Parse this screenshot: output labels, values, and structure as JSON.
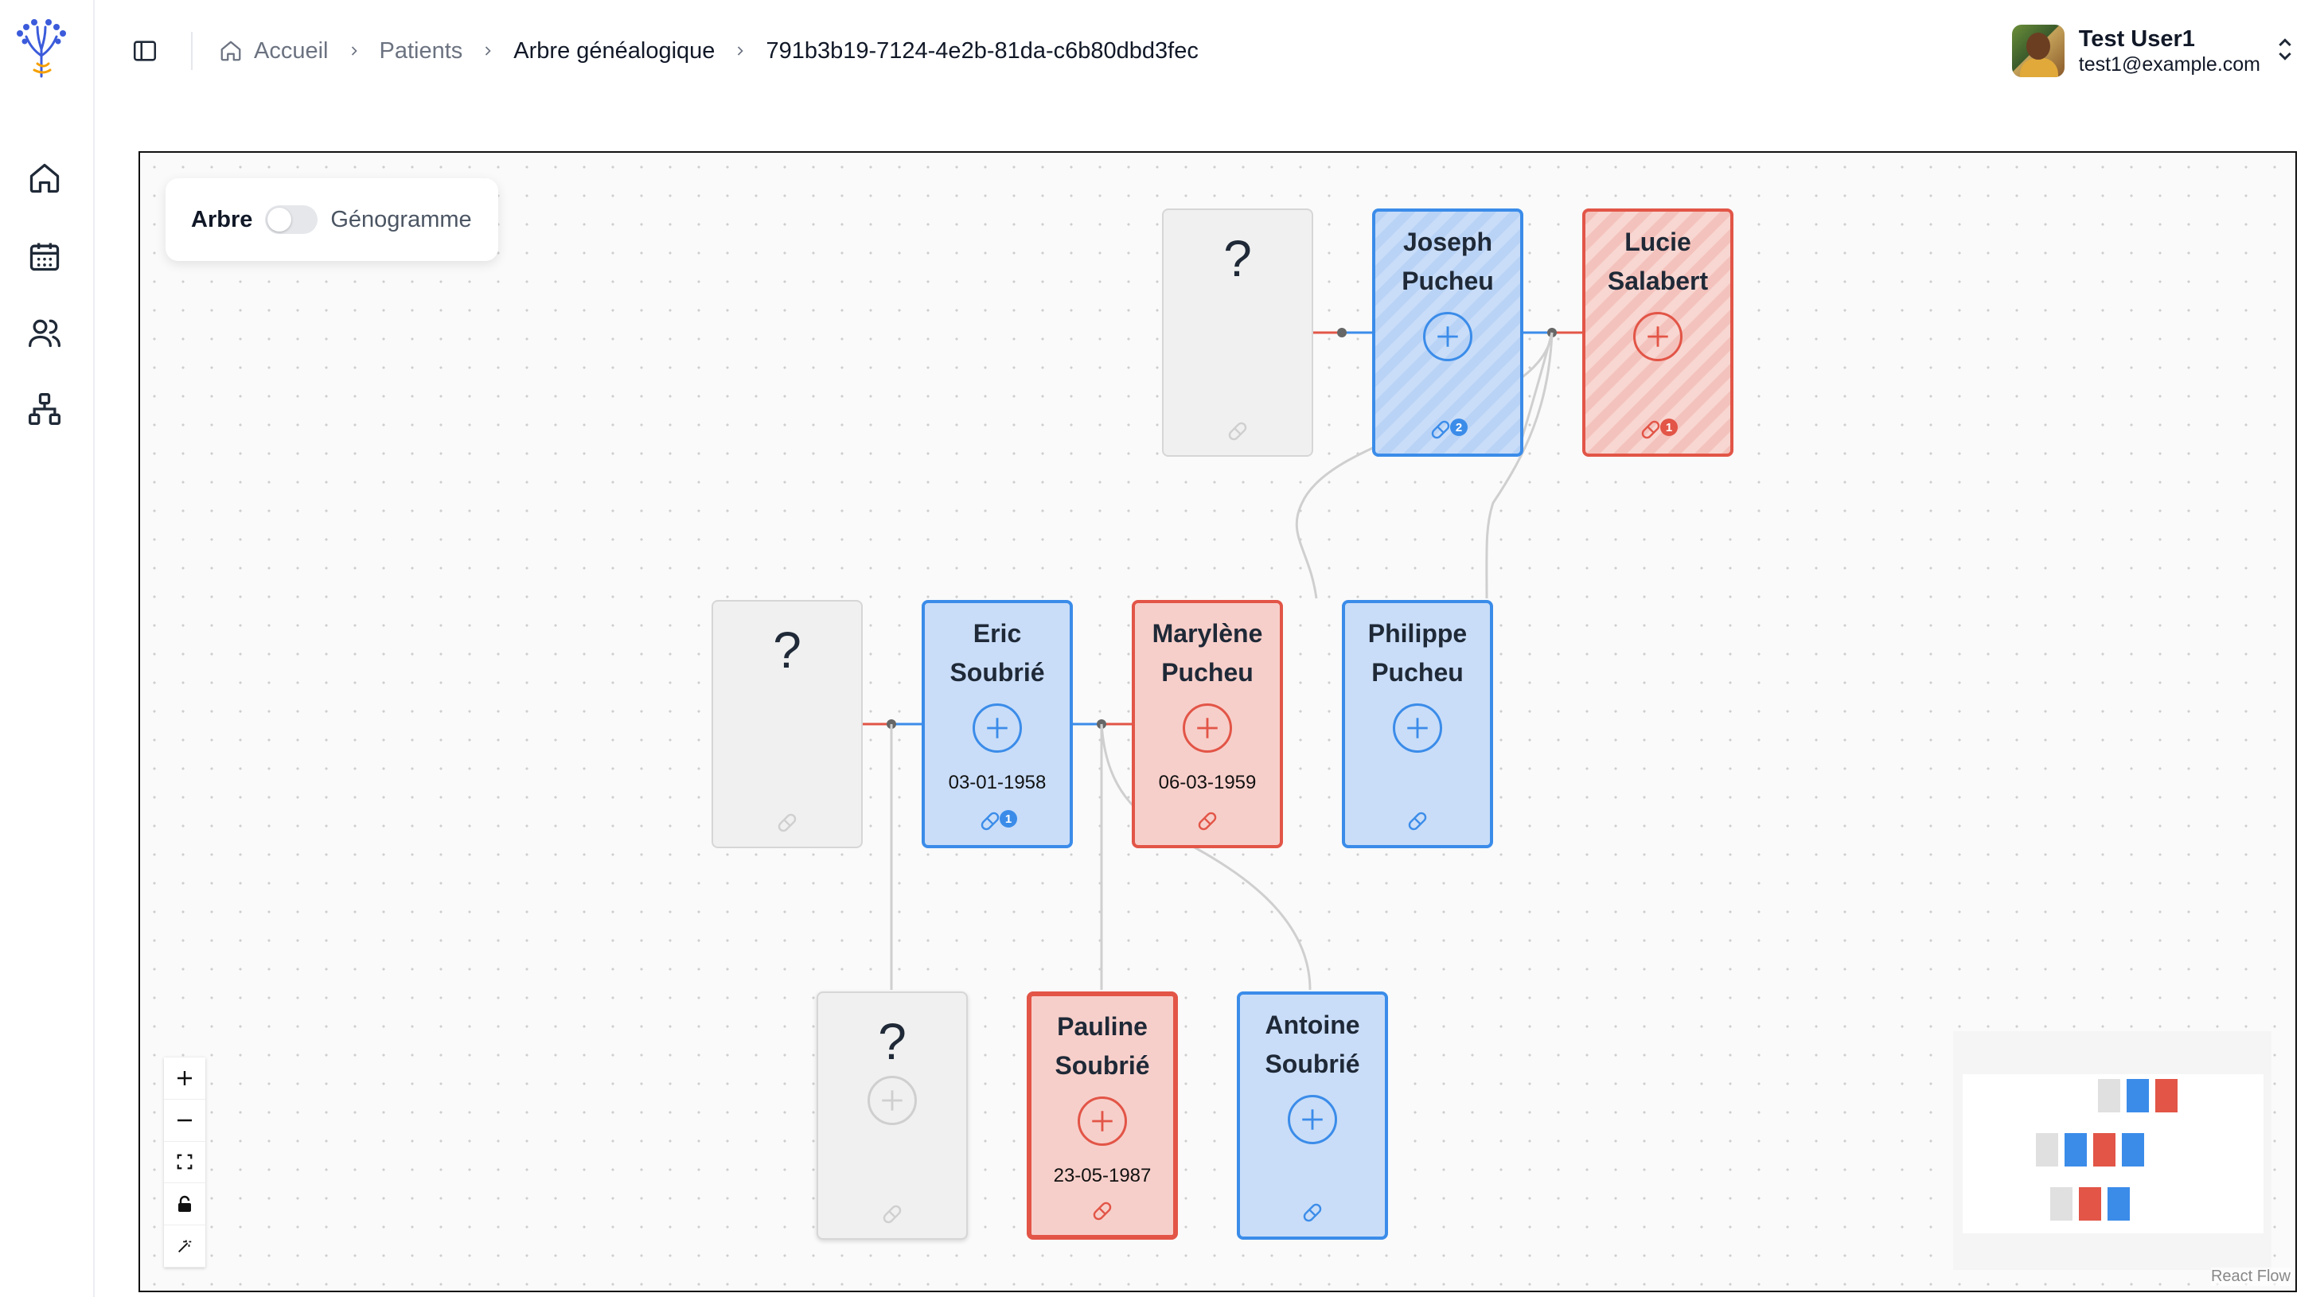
{
  "app": {
    "name": "Arbre généalogique"
  },
  "sidebar": {
    "items": [
      {
        "name": "home"
      },
      {
        "name": "calendar"
      },
      {
        "name": "patients"
      },
      {
        "name": "family-tree"
      }
    ]
  },
  "breadcrumb": {
    "items": [
      "Accueil",
      "Patients",
      "Arbre généalogique",
      "791b3b19-7124-4e2b-81da-c6b80dbd3fec"
    ]
  },
  "user": {
    "name": "Test User1",
    "email": "test1@example.com"
  },
  "view_toggle": {
    "left": "Arbre",
    "right": "Génogramme",
    "on": false
  },
  "colors": {
    "male": "#3b8ce9",
    "female": "#e25547",
    "unknown": "#d6d6d6",
    "edge": "#cfcfcf"
  },
  "nodes": [
    {
      "id": "u1",
      "kind": "unknown",
      "label": "?"
    },
    {
      "id": "joseph",
      "kind": "male",
      "first": "Joseph",
      "last": "Pucheu",
      "hatched": true,
      "treatments": 2
    },
    {
      "id": "lucie",
      "kind": "female",
      "first": "Lucie",
      "last": "Salabert",
      "hatched": true,
      "treatments": 1
    },
    {
      "id": "u2",
      "kind": "unknown",
      "label": "?"
    },
    {
      "id": "eric",
      "kind": "male",
      "first": "Eric",
      "last": "Soubrié",
      "date": "03-01-1958",
      "treatments": 1
    },
    {
      "id": "marylene",
      "kind": "female",
      "first": "Marylène",
      "last": "Pucheu",
      "date": "06-03-1959"
    },
    {
      "id": "philippe",
      "kind": "male",
      "first": "Philippe",
      "last": "Pucheu"
    },
    {
      "id": "u3",
      "kind": "unknown",
      "label": "?"
    },
    {
      "id": "pauline",
      "kind": "female",
      "first": "Pauline",
      "last": "Soubrié",
      "date": "23-05-1987",
      "selected": true
    },
    {
      "id": "antoine",
      "kind": "male",
      "first": "Antoine",
      "last": "Soubrié"
    }
  ],
  "attribution": "React Flow"
}
